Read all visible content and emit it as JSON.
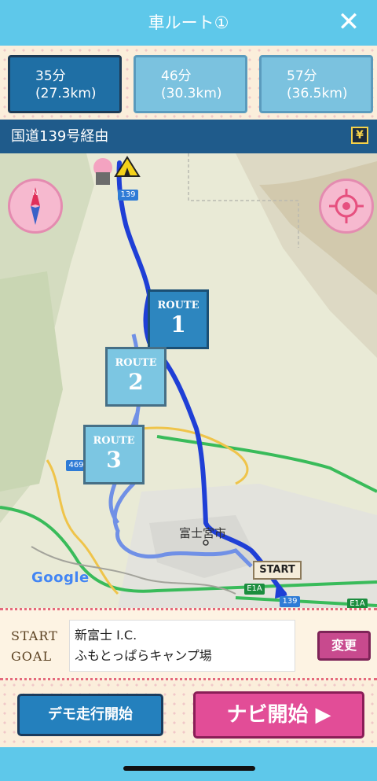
{
  "header": {
    "title": "車ルート①",
    "close_icon": "close-icon"
  },
  "routes": [
    {
      "time": "35分",
      "distance": "(27.3km)",
      "active": true
    },
    {
      "time": "46分",
      "distance": "(30.3km)",
      "active": false
    },
    {
      "time": "57分",
      "distance": "(36.5km)",
      "active": false
    }
  ],
  "via": {
    "text": "国道139号経由",
    "toll_symbol": "¥"
  },
  "map": {
    "route_labels": [
      {
        "word": "ROUTE",
        "num": "1"
      },
      {
        "word": "ROUTE",
        "num": "2"
      },
      {
        "word": "ROUTE",
        "num": "3"
      }
    ],
    "city": "富士宮市",
    "google": "Google",
    "start_flag": "START",
    "road_139": "139",
    "road_469": "469",
    "road_e1a": "E1A",
    "compass_icon": "compass-icon",
    "locate_icon": "crosshair-icon",
    "colors": {
      "route1": "#1f3fd6",
      "route_alt": "#6d8fe8",
      "highway": "#2fbf4f",
      "arterial": "#f0c244"
    }
  },
  "start_goal": {
    "start_label": "START",
    "goal_label": "GOAL",
    "start_value": "新富士 I.C.",
    "goal_value": "ふもとっぱらキャンプ場",
    "change_button": "変更"
  },
  "buttons": {
    "demo": "デモ走行開始",
    "navi": "ナビ開始 ▶"
  }
}
